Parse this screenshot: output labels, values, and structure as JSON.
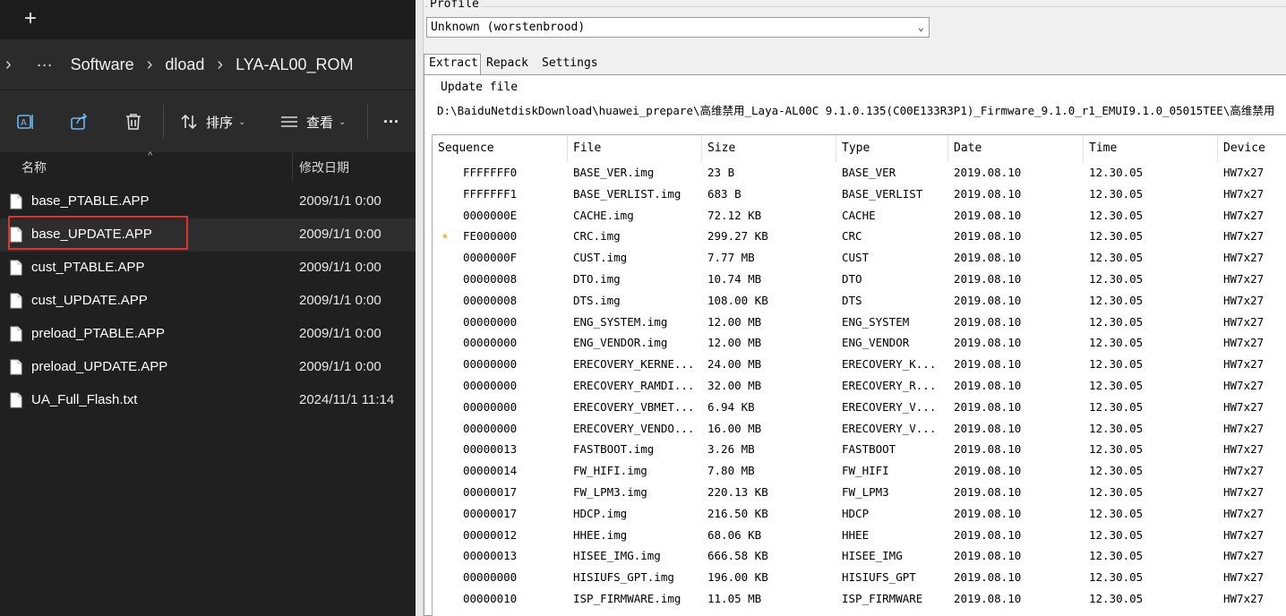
{
  "explorer": {
    "new_tab_label": "+",
    "breadcrumb": [
      "Software",
      "dload",
      "LYA-AL00_ROM"
    ],
    "breadcrumb_more": "···",
    "toolbar": {
      "sort_label": "排序",
      "view_label": "查看",
      "more_label": "···"
    },
    "columns": {
      "name": "名称",
      "date": "修改日期"
    },
    "files": [
      {
        "name": "base_PTABLE.APP",
        "date": "2009/1/1 0:00"
      },
      {
        "name": "base_UPDATE.APP",
        "date": "2009/1/1 0:00"
      },
      {
        "name": "cust_PTABLE.APP",
        "date": "2009/1/1 0:00"
      },
      {
        "name": "cust_UPDATE.APP",
        "date": "2009/1/1 0:00"
      },
      {
        "name": "preload_PTABLE.APP",
        "date": "2009/1/1 0:00"
      },
      {
        "name": "preload_UPDATE.APP",
        "date": "2009/1/1 0:00"
      },
      {
        "name": "UA_Full_Flash.txt",
        "date": "2024/11/1 11:14"
      }
    ],
    "selected_file": "base_UPDATE.APP",
    "highlight_color": "#e0332a"
  },
  "tool": {
    "profile_label": "Profile",
    "profile_value": "Unknown (worstenbrood)",
    "tabs": [
      "Extract",
      "Repack",
      "Settings"
    ],
    "active_tab": "Extract",
    "update_file_label": "Update file",
    "update_file_path": "D:\\BaiduNetdiskDownload\\huawei_prepare\\高维禁用_Laya-AL00C 9.1.0.135(C00E133R3P1)_Firmware_9.1.0_r1_EMUI9.1.0_05015TEE\\高维禁用",
    "columns": [
      "Sequence",
      "File",
      "Size",
      "Type",
      "Date",
      "Time",
      "Device"
    ],
    "rows": [
      {
        "seq": "FFFFFFF0",
        "file": "BASE_VER.img",
        "size": "23 B",
        "type": "BASE_VER",
        "date": "2019.08.10",
        "time": "12.30.05",
        "device": "HW7x27"
      },
      {
        "seq": "FFFFFFF1",
        "file": "BASE_VERLIST.img",
        "size": "683 B",
        "type": "BASE_VERLIST",
        "date": "2019.08.10",
        "time": "12.30.05",
        "device": "HW7x27"
      },
      {
        "seq": "0000000E",
        "file": "CACHE.img",
        "size": "72.12 KB",
        "type": "CACHE",
        "date": "2019.08.10",
        "time": "12.30.05",
        "device": "HW7x27"
      },
      {
        "seq": "FE000000",
        "file": "CRC.img",
        "size": "299.27 KB",
        "type": "CRC",
        "date": "2019.08.10",
        "time": "12.30.05",
        "device": "HW7x27",
        "starred": true
      },
      {
        "seq": "0000000F",
        "file": "CUST.img",
        "size": "7.77 MB",
        "type": "CUST",
        "date": "2019.08.10",
        "time": "12.30.05",
        "device": "HW7x27"
      },
      {
        "seq": "00000008",
        "file": "DTO.img",
        "size": "10.74 MB",
        "type": "DTO",
        "date": "2019.08.10",
        "time": "12.30.05",
        "device": "HW7x27"
      },
      {
        "seq": "00000008",
        "file": "DTS.img",
        "size": "108.00 KB",
        "type": "DTS",
        "date": "2019.08.10",
        "time": "12.30.05",
        "device": "HW7x27"
      },
      {
        "seq": "00000000",
        "file": "ENG_SYSTEM.img",
        "size": "12.00 MB",
        "type": "ENG_SYSTEM",
        "date": "2019.08.10",
        "time": "12.30.05",
        "device": "HW7x27"
      },
      {
        "seq": "00000000",
        "file": "ENG_VENDOR.img",
        "size": "12.00 MB",
        "type": "ENG_VENDOR",
        "date": "2019.08.10",
        "time": "12.30.05",
        "device": "HW7x27"
      },
      {
        "seq": "00000000",
        "file": "ERECOVERY_KERNE...",
        "size": "24.00 MB",
        "type": "ERECOVERY_K...",
        "date": "2019.08.10",
        "time": "12.30.05",
        "device": "HW7x27"
      },
      {
        "seq": "00000000",
        "file": "ERECOVERY_RAMDI...",
        "size": "32.00 MB",
        "type": "ERECOVERY_R...",
        "date": "2019.08.10",
        "time": "12.30.05",
        "device": "HW7x27"
      },
      {
        "seq": "00000000",
        "file": "ERECOVERY_VBMET...",
        "size": "6.94 KB",
        "type": "ERECOVERY_V...",
        "date": "2019.08.10",
        "time": "12.30.05",
        "device": "HW7x27"
      },
      {
        "seq": "00000000",
        "file": "ERECOVERY_VENDO...",
        "size": "16.00 MB",
        "type": "ERECOVERY_V...",
        "date": "2019.08.10",
        "time": "12.30.05",
        "device": "HW7x27"
      },
      {
        "seq": "00000013",
        "file": "FASTBOOT.img",
        "size": "3.26 MB",
        "type": "FASTBOOT",
        "date": "2019.08.10",
        "time": "12.30.05",
        "device": "HW7x27"
      },
      {
        "seq": "00000014",
        "file": "FW_HIFI.img",
        "size": "7.80 MB",
        "type": "FW_HIFI",
        "date": "2019.08.10",
        "time": "12.30.05",
        "device": "HW7x27"
      },
      {
        "seq": "00000017",
        "file": "FW_LPM3.img",
        "size": "220.13 KB",
        "type": "FW_LPM3",
        "date": "2019.08.10",
        "time": "12.30.05",
        "device": "HW7x27"
      },
      {
        "seq": "00000017",
        "file": "HDCP.img",
        "size": "216.50 KB",
        "type": "HDCP",
        "date": "2019.08.10",
        "time": "12.30.05",
        "device": "HW7x27"
      },
      {
        "seq": "00000012",
        "file": "HHEE.img",
        "size": "68.06 KB",
        "type": "HHEE",
        "date": "2019.08.10",
        "time": "12.30.05",
        "device": "HW7x27"
      },
      {
        "seq": "00000013",
        "file": "HISEE_IMG.img",
        "size": "666.58 KB",
        "type": "HISEE_IMG",
        "date": "2019.08.10",
        "time": "12.30.05",
        "device": "HW7x27"
      },
      {
        "seq": "00000000",
        "file": "HISIUFS_GPT.img",
        "size": "196.00 KB",
        "type": "HISIUFS_GPT",
        "date": "2019.08.10",
        "time": "12.30.05",
        "device": "HW7x27"
      },
      {
        "seq": "00000010",
        "file": "ISP_FIRMWARE.img",
        "size": "11.05 MB",
        "type": "ISP_FIRMWARE",
        "date": "2019.08.10",
        "time": "12.30.05",
        "device": "HW7x27"
      }
    ],
    "star_color": "#e8b13a"
  }
}
